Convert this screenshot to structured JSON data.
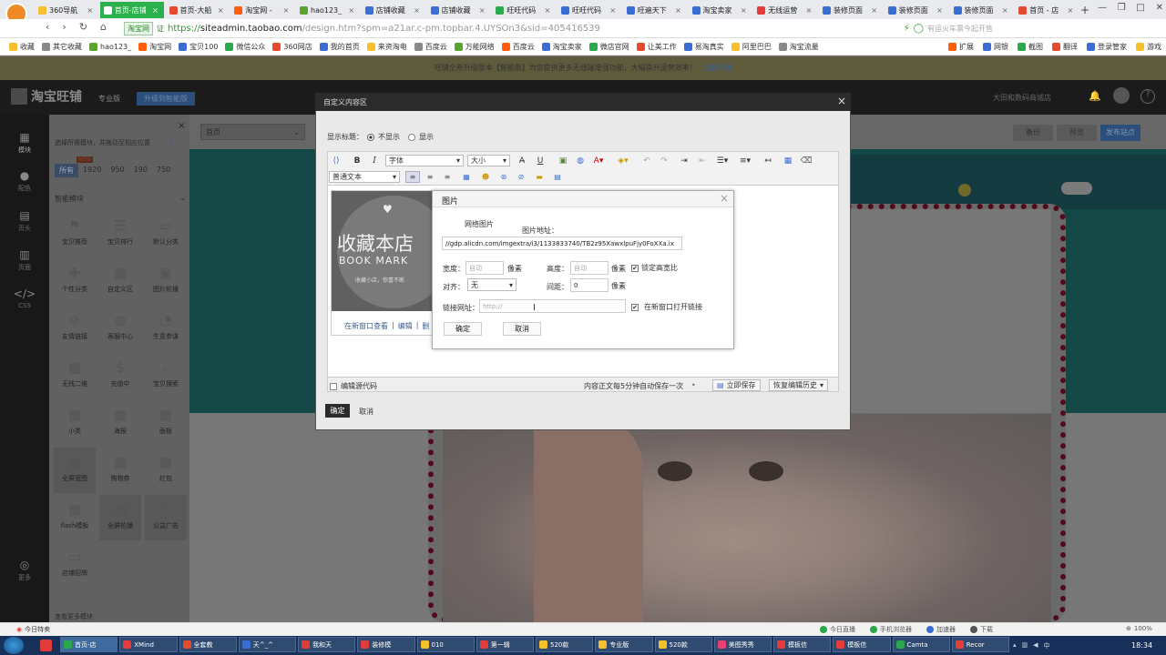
{
  "browser": {
    "tabs": [
      {
        "label": "360导航",
        "color": "#f5c02c",
        "active": false
      },
      {
        "label": "首页-店铺",
        "color": "#ffffff",
        "active": true
      },
      {
        "label": "首页-大船",
        "color": "#e44a2e",
        "active": false
      },
      {
        "label": "淘宝网 -",
        "color": "#ff5d0c",
        "active": false
      },
      {
        "label": "hao123_",
        "color": "#5aa32e",
        "active": false
      },
      {
        "label": "店铺收藏",
        "color": "#3b6ed3",
        "active": false
      },
      {
        "label": "店铺收藏",
        "color": "#3b6ed3",
        "active": false
      },
      {
        "label": "旺旺代码",
        "color": "#29a84c",
        "active": false
      },
      {
        "label": "旺旺代码",
        "color": "#3b6ed3",
        "active": false
      },
      {
        "label": "旺遍天下",
        "color": "#3b6ed3",
        "active": false
      },
      {
        "label": "淘宝卖家",
        "color": "#3b6ed3",
        "active": false
      },
      {
        "label": "无线运营",
        "color": "#e43b3b",
        "active": false
      },
      {
        "label": "装修页面",
        "color": "#3b6ed3",
        "active": false
      },
      {
        "label": "装修页面",
        "color": "#3b6ed3",
        "active": false
      },
      {
        "label": "装修页面",
        "color": "#3b6ed3",
        "active": false
      },
      {
        "label": "首页 - 店",
        "color": "#e44a2e",
        "active": false
      }
    ],
    "tab_close": "×",
    "new_tab": "+",
    "address": {
      "site_badge": "淘宝网",
      "badge_tag": "证",
      "https": "https://",
      "host": "siteadmin.taobao.com",
      "path": "/design.htm?spm=a21ar.c-pm.topbar.4.UYSOn3&sid=405416539"
    },
    "search_placeholder": "有运火车票今起开售",
    "bookmarks": [
      "收藏",
      "其它收藏",
      "hao123_",
      "淘宝网",
      "宝贝100",
      "微信公众",
      "360网店",
      "我的首页",
      "来资淘电",
      "百度云",
      "万能网络",
      "百度云",
      "淘宝卖家",
      "微店官网",
      "让美工作",
      "易淘真实",
      "阿里巴巴",
      "淘宝流量"
    ],
    "bm_right": [
      "扩展",
      "网银",
      "截图",
      "翻译",
      "登录管家",
      "游戏"
    ],
    "notice": "旺铺全新升级版本【智能版】为您提供更多无线端增强功能，大幅提升运营效率！",
    "notice_link": "立即开通"
  },
  "app": {
    "logo": "淘宝旺铺",
    "edition": "专业版",
    "upgrade": "升级到智能版",
    "shop_name": "大田和数码商城店",
    "header_btns": [
      "备份",
      "预览",
      "发布站点"
    ],
    "left_nav": [
      {
        "icon": "▦",
        "label": "模块"
      },
      {
        "icon": "●",
        "label": "配色"
      },
      {
        "icon": "▤",
        "label": "页头"
      },
      {
        "icon": "▥",
        "label": "页面"
      },
      {
        "icon": "</>",
        "label": "CSS"
      },
      {
        "icon": "◎",
        "label": "更多"
      }
    ],
    "panel_hint": "选择所需模块，并拖动至相应位置",
    "panel_close": "×",
    "width_tabs": [
      "所有",
      "1920",
      "950",
      "190",
      "750"
    ],
    "width_tag": "NEW",
    "smart_group": "智能模块",
    "modules": [
      {
        "icon": "⚑",
        "label": "宝贝推荐"
      },
      {
        "icon": "☰",
        "label": "宝贝排行"
      },
      {
        "icon": "▭",
        "label": "默认分类"
      },
      {
        "icon": "✚",
        "label": "个性分类"
      },
      {
        "icon": "▦",
        "label": "自定义区"
      },
      {
        "icon": "▣",
        "label": "图片轮播"
      },
      {
        "icon": "⊘",
        "label": "友情链接"
      },
      {
        "icon": "◍",
        "label": "客服中心"
      },
      {
        "icon": "◔",
        "label": "生意参谋"
      },
      {
        "icon": "▩",
        "label": "无线二维"
      },
      {
        "icon": "$",
        "label": "充值中"
      },
      {
        "icon": "⌕",
        "label": "宝贝搜索"
      },
      {
        "icon": "▦",
        "label": "小类"
      },
      {
        "icon": "▦",
        "label": "海报"
      },
      {
        "icon": "▦",
        "label": "面板"
      },
      {
        "icon": "▦",
        "label": "全屏宽图"
      },
      {
        "icon": "▦",
        "label": "购物券"
      },
      {
        "icon": "▦",
        "label": "红包"
      },
      {
        "icon": "▦",
        "label": "flash模板"
      },
      {
        "icon": "▦",
        "label": "全屏轮播"
      },
      {
        "icon": "♡",
        "label": "公益广告"
      },
      {
        "icon": "▭",
        "label": "店铺招牌"
      }
    ],
    "panel_footer": "查看更多模块",
    "page_select": "首页"
  },
  "dialog": {
    "title": "自定义内容区",
    "close": "×",
    "show_title_label": "显示标题：",
    "radio_hide": "不显示",
    "radio_show": "显示",
    "font_select": "字体",
    "size_select": "大小",
    "format_select": "普通文本",
    "editor_image": {
      "title": "收藏本店",
      "subtitle": "BOOK MARK",
      "slogan": "收藏小店，惊喜不断"
    },
    "image_links": [
      "在新窗口查看",
      "编辑",
      "删"
    ],
    "source_label": "编辑源代码",
    "autosave": "内容正文每5分钟自动保存一次",
    "save_now": "立即保存",
    "restore": "恢复编辑历史",
    "ok": "确定",
    "cancel": "取消"
  },
  "image_dialog": {
    "title": "图片",
    "close": "×",
    "tab": "网络图片",
    "url_label": "图片地址：",
    "url_value": "//gdp.alicdn.com/imgextra/i3/1133833740/TB2z95XawxlpuFjy0FoXXa.ix",
    "width_label": "宽度：",
    "width_ph": "自动",
    "height_label": "高度：",
    "height_ph": "自动",
    "px": "像素",
    "lock_ratio": "锁定高宽比",
    "align_label": "对齐：",
    "align_value": "无",
    "spacing_label": "间距：",
    "spacing_value": "0",
    "link_label": "链接网址：",
    "link_ph": "http://",
    "new_window": "在新窗口打开链接",
    "ok": "确定",
    "cancel": "取消"
  },
  "statusbar": {
    "left": "今日特卖",
    "items": [
      "今日直播",
      "手机浏览器",
      "加速器",
      "下载"
    ],
    "zoom": "100%"
  },
  "taskbar": {
    "items": [
      {
        "label": "首页-店",
        "color": "#29a84c"
      },
      {
        "label": "XMind",
        "color": "#e43b3b"
      },
      {
        "label": "全套教",
        "color": "#e44a2e"
      },
      {
        "label": "天^_^",
        "color": "#3b6ed3"
      },
      {
        "label": "我和天",
        "color": "#e43b3b"
      },
      {
        "label": "装修模",
        "color": "#e43b3b"
      },
      {
        "label": "010",
        "color": "#f5c02c"
      },
      {
        "label": "第一辑",
        "color": "#e43b3b"
      },
      {
        "label": "520款",
        "color": "#f5c02c"
      },
      {
        "label": "专业版",
        "color": "#f5c02c"
      },
      {
        "label": "520款",
        "color": "#f5c02c"
      },
      {
        "label": "美图秀秀",
        "color": "#e83f76"
      },
      {
        "label": "模板信",
        "color": "#e43b3b"
      },
      {
        "label": "模板信",
        "color": "#e43b3b"
      },
      {
        "label": "Camta",
        "color": "#29a84c"
      },
      {
        "label": "Recor",
        "color": "#e43b3b"
      }
    ],
    "time": "18:34"
  },
  "colors": {
    "taobao_orange": "#ff5000",
    "teal": "#289a9a",
    "tab_active": "#2ab14b",
    "dialog_dark": "#2b2b2b"
  }
}
